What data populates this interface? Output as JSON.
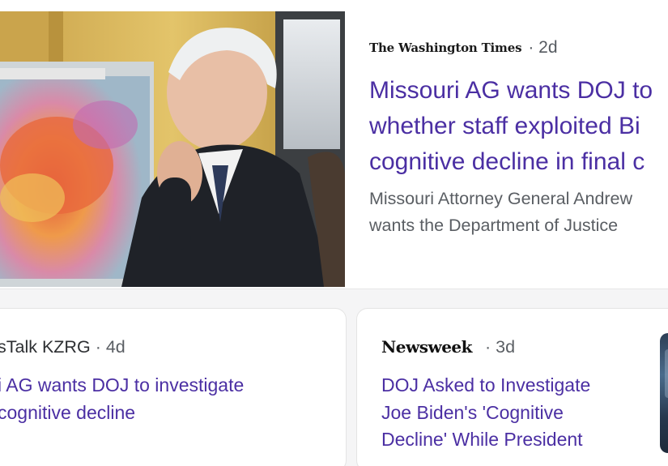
{
  "top_story": {
    "image_alt": "Joe Biden seated in the Oval Office, hand at his chin, in front of a weather map",
    "source_logo": "The Washington Times",
    "time": "· 2d",
    "title": "Missouri AG wants DOJ to\nwhether staff exploited Bi\ncognitive decline in final c",
    "snippet": "Missouri Attorney General Andrew\nwants the Department of Justice"
  },
  "stories": [
    {
      "source": "sTalk KZRG",
      "time": "· 4d",
      "title": "i AG wants DOJ to investigate\ncognitive decline"
    },
    {
      "source_logo": "Newsweek",
      "time": "· 3d",
      "title": "DOJ Asked to Investigate\nJoe Biden's 'Cognitive\nDecline' While President"
    }
  ],
  "colors": {
    "headline": "#4b2fa3",
    "snippet": "#5a5e63",
    "card_bg": "#ffffff",
    "page_bg": "#f5f5f6"
  }
}
